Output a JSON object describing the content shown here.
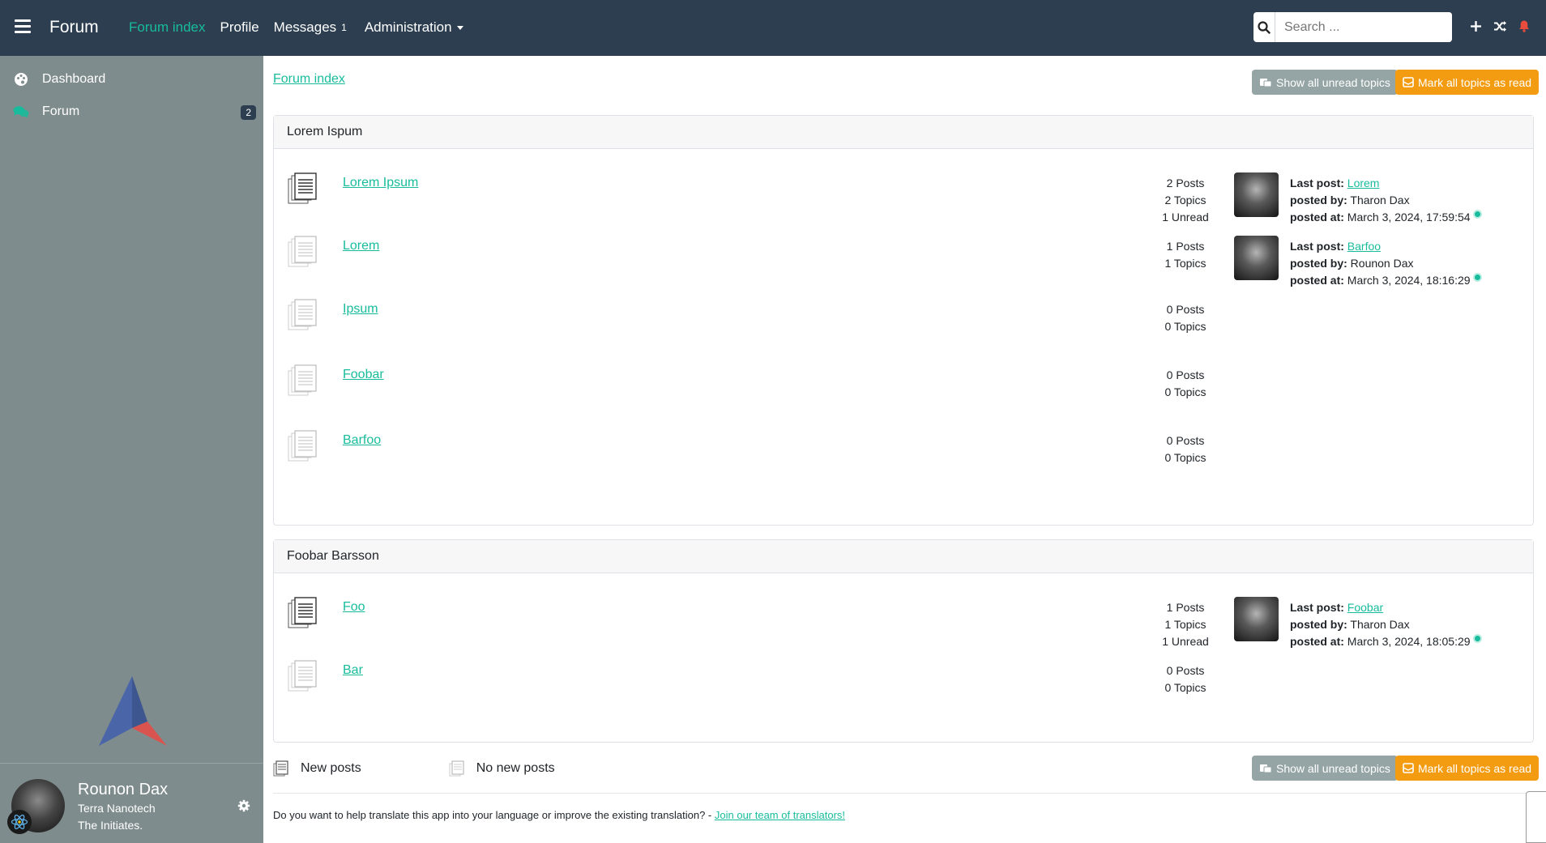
{
  "topbar": {
    "brand": "Forum",
    "nav": {
      "forum_index": "Forum index",
      "profile": "Profile",
      "messages": "Messages",
      "messages_badge": "1",
      "administration": "Administration"
    },
    "search": {
      "placeholder": "Search ..."
    }
  },
  "sidebar": {
    "dashboard": "Dashboard",
    "forum": "Forum",
    "forum_badge": "2",
    "user": {
      "name": "Rounon Dax",
      "corporation": "Terra Nanotech",
      "alliance": "The Initiates."
    }
  },
  "main": {
    "breadcrumb": "Forum index",
    "show_unread": "Show all unread topics",
    "mark_read": "Mark all topics as read",
    "categories": [
      {
        "name": "Lorem Ispum",
        "boards": [
          {
            "name": "Lorem Ipsum",
            "posts": "2 Posts",
            "topics": "2 Topics",
            "unread": "1 Unread",
            "last_label": "Last post:",
            "last_post": "Lorem",
            "by_label": "posted by:",
            "by": "Tharon Dax",
            "at_label": "posted at:",
            "at": "March 3, 2024, 17:59:54"
          },
          {
            "name": "Lorem",
            "posts": "1 Posts",
            "topics": "1 Topics",
            "last_label": "Last post:",
            "last_post": "Barfoo",
            "by_label": "posted by:",
            "by": "Rounon Dax",
            "at_label": "posted at:",
            "at": "March 3, 2024, 18:16:29"
          },
          {
            "name": "Ipsum",
            "posts": "0 Posts",
            "topics": "0 Topics"
          },
          {
            "name": "Foobar",
            "posts": "0 Posts",
            "topics": "0 Topics"
          },
          {
            "name": "Barfoo",
            "posts": "0 Posts",
            "topics": "0 Topics"
          }
        ]
      },
      {
        "name": "Foobar Barsson",
        "boards": [
          {
            "name": "Foo",
            "posts": "1 Posts",
            "topics": "1 Topics",
            "unread": "1 Unread",
            "last_label": "Last post:",
            "last_post": "Foobar",
            "by_label": "posted by:",
            "by": "Tharon Dax",
            "at_label": "posted at:",
            "at": "March 3, 2024, 18:05:29"
          },
          {
            "name": "Bar",
            "posts": "0 Posts",
            "topics": "0 Topics"
          }
        ]
      }
    ],
    "legend": {
      "new_posts": "New posts",
      "no_new_posts": "No new posts"
    },
    "translate": {
      "text": "Do you want to help translate this app into your language or improve the existing translation? - ",
      "link": "Join our team of translators!"
    }
  },
  "colors": {
    "navbar": "#2c3e50",
    "sidebar": "#7f8c8d",
    "accent": "#18bc9c",
    "grey_button": "#95a5a6",
    "orange_button": "#f39c12",
    "notification": "#e74c3c"
  },
  "icons": {
    "menu": "hamburger-icon",
    "search": "search-icon",
    "add": "plus-icon",
    "random": "shuffle-icon",
    "notifications": "bell-icon",
    "dashboard": "palette-icon",
    "forum": "comments-icon",
    "settings": "gear-icon",
    "board_new": "document-stack-icon",
    "board_read": "document-stack-faded-icon"
  }
}
